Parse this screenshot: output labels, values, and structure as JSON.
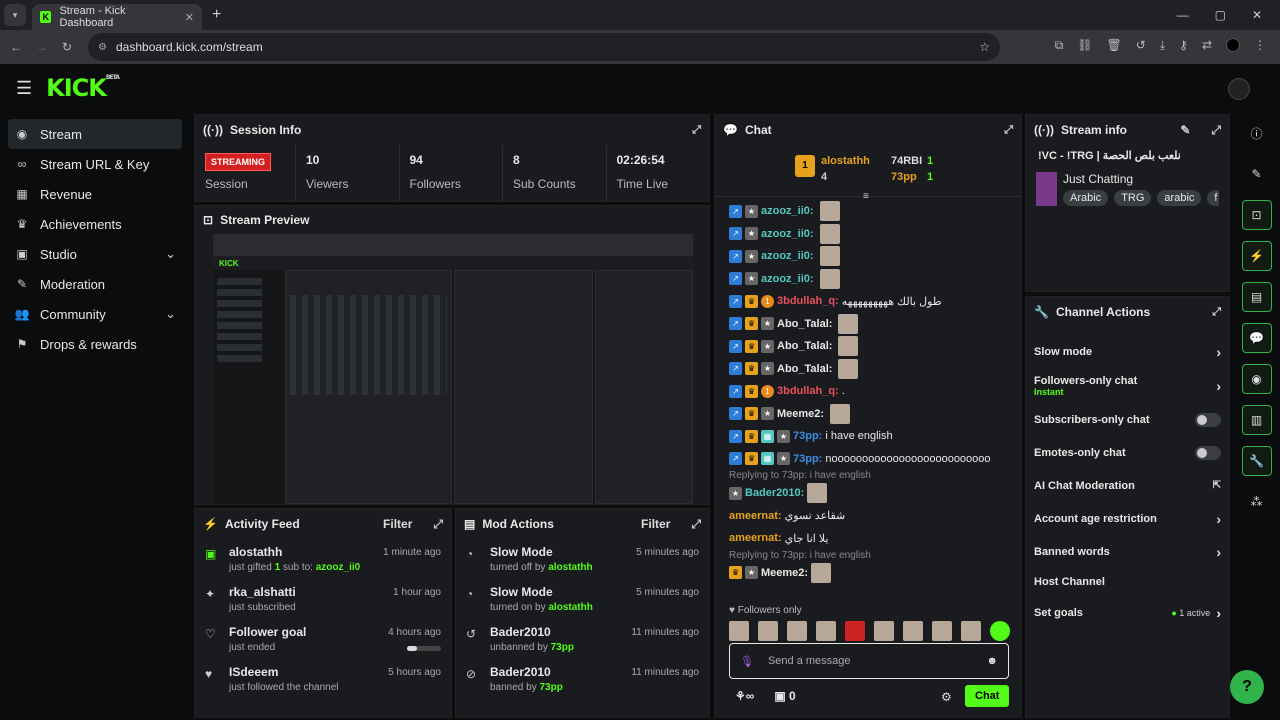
{
  "browser": {
    "tab_title": "Stream - Kick Dashboard",
    "url": "dashboard.kick.com/stream"
  },
  "brand": {
    "logo": "KICK",
    "beta": "BETA"
  },
  "sidebar": {
    "items": [
      {
        "label": "Stream",
        "icon": "stream-icon"
      },
      {
        "label": "Stream URL & Key",
        "icon": "link-icon"
      },
      {
        "label": "Revenue",
        "icon": "revenue-icon"
      },
      {
        "label": "Achievements",
        "icon": "trophy-icon"
      },
      {
        "label": "Studio",
        "icon": "studio-icon"
      },
      {
        "label": "Moderation",
        "icon": "wrench-icon"
      },
      {
        "label": "Community",
        "icon": "community-icon"
      },
      {
        "label": "Drops & rewards",
        "icon": "drops-icon"
      }
    ]
  },
  "session": {
    "title": "Session Info",
    "status": "STREAMING",
    "status_label": "Session",
    "stats": [
      {
        "value": "10",
        "label": "Viewers"
      },
      {
        "value": "94",
        "label": "Followers"
      },
      {
        "value": "8",
        "label": "Sub Counts"
      },
      {
        "value": "02:26:54",
        "label": "Time Live"
      }
    ]
  },
  "preview": {
    "title": "Stream Preview"
  },
  "activity": {
    "title": "Activity Feed",
    "filter": "Filter",
    "items": [
      {
        "name": "alostathh",
        "pre": "just gifted ",
        "count": "1",
        "mid": " sub to: ",
        "target": "azooz_ii0",
        "time": "1 minute ago"
      },
      {
        "name": "rka_alshatti",
        "sub": "just subscribed",
        "time": "1 hour ago"
      },
      {
        "name": "Follower goal",
        "sub": "just ended",
        "time": "4 hours ago",
        "progress": 0.3
      },
      {
        "name": "ISdeeem",
        "sub": "just followed the channel",
        "time": "5 hours ago"
      }
    ]
  },
  "mod": {
    "title": "Mod Actions",
    "filter": "Filter",
    "items": [
      {
        "name": "Slow Mode",
        "pre": "turned off by ",
        "by": "alostathh",
        "time": "5 minutes ago"
      },
      {
        "name": "Slow Mode",
        "pre": "turned on by ",
        "by": "alostathh",
        "time": "5 minutes ago"
      },
      {
        "name": "Bader2010",
        "pre": "unbanned by ",
        "by": "73pp",
        "time": "11 minutes ago"
      },
      {
        "name": "Bader2010",
        "pre": "banned by ",
        "by": "73pp",
        "time": "11 minutes ago"
      }
    ]
  },
  "chat": {
    "title": "Chat",
    "top_gifter": "alostathh",
    "top_gifter_count": "4",
    "g2": "74RBI",
    "g2c": "1",
    "g3": "73pp",
    "g3c": "1",
    "crown_rank": "1",
    "messages": [
      {
        "user": "azooz_ii0:",
        "color": "#53c8c0",
        "text": ""
      },
      {
        "user": "azooz_ii0:",
        "color": "#53c8c0",
        "text": ""
      },
      {
        "user": "azooz_ii0:",
        "color": "#53c8c0",
        "text": ""
      },
      {
        "user": "azooz_ii0:",
        "color": "#53c8c0",
        "text": ""
      },
      {
        "user": "3bdullah_q:",
        "color": "#e8505b",
        "text": "طول بالك هههههههههه"
      },
      {
        "user": "Abo_Talal:",
        "color": "#e8e8e8",
        "text": ""
      },
      {
        "user": "Abo_Talal:",
        "color": "#e8e8e8",
        "text": ""
      },
      {
        "user": "Abo_Talal:",
        "color": "#e8e8e8",
        "text": ""
      },
      {
        "user": "3bdullah_q:",
        "color": "#e8505b",
        "text": "."
      },
      {
        "user": "Meeme2:",
        "color": "#e8e8e8",
        "text": ""
      },
      {
        "user": "73pp:",
        "color": "#3a8ee6",
        "text": "i have english"
      },
      {
        "user": "73pp:",
        "color": "#3a8ee6",
        "text": "noooooooooooooooooooooooooo"
      }
    ],
    "reply1": "Replying to 73pp: i have english",
    "bader": "Bader2010:",
    "amee1": "ameernat:",
    "amee1_text": "شقاعد تسوي",
    "amee2": "ameernat:",
    "amee2_text": "يلا انا جاي",
    "reply2": "Replying to 73pp: i have english",
    "meeme": "Meeme2:",
    "followers_only": "Followers only",
    "placeholder": "Send a message",
    "points": "0",
    "send": "Chat"
  },
  "stream_info": {
    "title": "Stream info",
    "stream_title": "!VC - !TRG | نلعب بلص الحصة",
    "category": "Just Chatting",
    "tags": [
      "Arabic",
      "TRG",
      "arabic",
      "f"
    ]
  },
  "actions": {
    "title": "Channel Actions",
    "items": [
      {
        "label": "Slow mode",
        "kind": "chev"
      },
      {
        "label": "Followers-only chat",
        "sub": "Instant",
        "kind": "chev"
      },
      {
        "label": "Subscribers-only chat",
        "kind": "toggle"
      },
      {
        "label": "Emotes-only chat",
        "kind": "toggle"
      },
      {
        "label": "AI Chat Moderation",
        "kind": "ext"
      },
      {
        "label": "Account age restriction",
        "kind": "chev"
      },
      {
        "label": "Banned words",
        "kind": "chev"
      },
      {
        "label": "Host Channel",
        "kind": "none"
      },
      {
        "label": "Set goals",
        "status": "1 active",
        "kind": "chev"
      }
    ]
  },
  "colors": {
    "accent": "#53fc18",
    "live": "#d42020"
  }
}
